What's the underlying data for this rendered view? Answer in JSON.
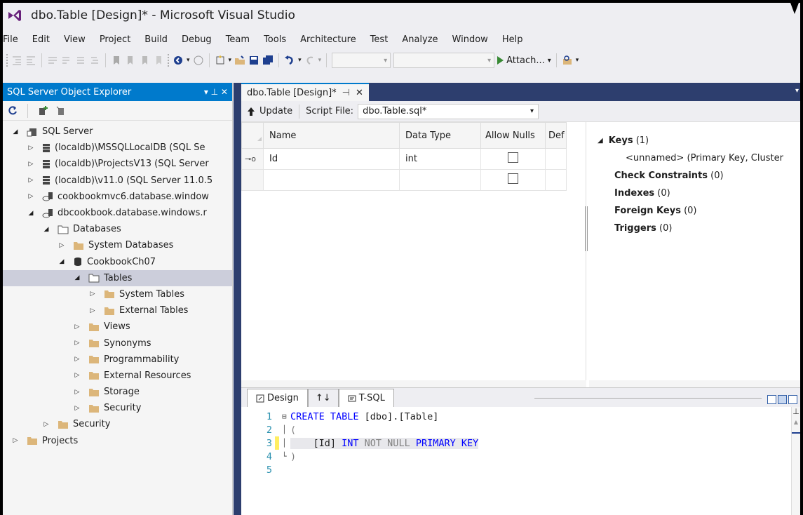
{
  "window": {
    "title": "dbo.Table [Design]* - Microsoft Visual Studio"
  },
  "menu": [
    "File",
    "Edit",
    "View",
    "Project",
    "Build",
    "Debug",
    "Team",
    "Tools",
    "Architecture",
    "Test",
    "Analyze",
    "Window",
    "Help"
  ],
  "toolbar": {
    "attach_label": "Attach...",
    "attach_dropdown": "▾"
  },
  "explorer": {
    "title": "SQL Server Object Explorer",
    "pin_glyph": "▾ ⊥ ✕",
    "tree": [
      {
        "label": "SQL Server",
        "level": 0,
        "arrow": "expanded",
        "icon": "server-group-icon"
      },
      {
        "label": "(localdb)\\MSSQLLocalDB (SQL Se",
        "level": 1,
        "arrow": "collapsed",
        "icon": "server-icon"
      },
      {
        "label": "(localdb)\\ProjectsV13 (SQL Server",
        "level": 1,
        "arrow": "collapsed",
        "icon": "server-icon"
      },
      {
        "label": "(localdb)\\v11.0 (SQL Server 11.0.5",
        "level": 1,
        "arrow": "collapsed",
        "icon": "server-icon"
      },
      {
        "label": "cookbookmvc6.database.window",
        "level": 1,
        "arrow": "collapsed",
        "icon": "azure-server-icon"
      },
      {
        "label": "dbcookbook.database.windows.r",
        "level": 1,
        "arrow": "expanded",
        "icon": "azure-server-icon"
      },
      {
        "label": "Databases",
        "level": 2,
        "arrow": "expanded",
        "icon": "folder-open-icon"
      },
      {
        "label": "System Databases",
        "level": 3,
        "arrow": "collapsed",
        "icon": "folder-icon"
      },
      {
        "label": "CookbookCh07",
        "level": 3,
        "arrow": "expanded",
        "icon": "database-icon"
      },
      {
        "label": "Tables",
        "level": 4,
        "arrow": "expanded",
        "icon": "folder-open-icon",
        "selected": true
      },
      {
        "label": "System Tables",
        "level": 5,
        "arrow": "collapsed",
        "icon": "folder-icon"
      },
      {
        "label": "External Tables",
        "level": 5,
        "arrow": "collapsed",
        "icon": "folder-icon"
      },
      {
        "label": "Views",
        "level": 4,
        "arrow": "collapsed",
        "icon": "folder-icon"
      },
      {
        "label": "Synonyms",
        "level": 4,
        "arrow": "collapsed",
        "icon": "folder-icon"
      },
      {
        "label": "Programmability",
        "level": 4,
        "arrow": "collapsed",
        "icon": "folder-icon"
      },
      {
        "label": "External Resources",
        "level": 4,
        "arrow": "collapsed",
        "icon": "folder-icon"
      },
      {
        "label": "Storage",
        "level": 4,
        "arrow": "collapsed",
        "icon": "folder-icon"
      },
      {
        "label": "Security",
        "level": 4,
        "arrow": "collapsed",
        "icon": "folder-icon"
      },
      {
        "label": "Security",
        "level": 2,
        "arrow": "collapsed",
        "icon": "folder-icon"
      },
      {
        "label": "Projects",
        "level": 0,
        "arrow": "collapsed",
        "icon": "folder-icon"
      }
    ]
  },
  "doc_tab": {
    "label": "dbo.Table [Design]*",
    "pin": "⊣",
    "close": "✕"
  },
  "designer": {
    "update_label": "Update",
    "script_file_label": "Script File:",
    "script_file_value": "dbo.Table.sql*",
    "columns_header": [
      "Name",
      "Data Type",
      "Allow Nulls",
      "Def"
    ],
    "rows": [
      {
        "name": "Id",
        "type": "int",
        "allow_nulls": false,
        "is_key": true
      },
      {
        "name": "",
        "type": "",
        "allow_nulls": false,
        "is_key": false
      }
    ],
    "props": {
      "keys_label": "Keys",
      "keys_count": "(1)",
      "keys_item": "<unnamed>  (Primary Key, Cluster",
      "check_label": "Check Constraints",
      "check_count": "(0)",
      "indexes_label": "Indexes",
      "indexes_count": "(0)",
      "fk_label": "Foreign Keys",
      "fk_count": "(0)",
      "triggers_label": "Triggers",
      "triggers_count": "(0)"
    },
    "bottom_tabs": {
      "design": "Design",
      "swap": "↑↓",
      "tsql": "T-SQL"
    }
  },
  "code": [
    {
      "num": "1",
      "fold": "⊟",
      "parts": [
        [
          "kw",
          "CREATE TABLE "
        ],
        [
          "",
          "[dbo]."
        ],
        [
          "",
          "[Table]"
        ]
      ]
    },
    {
      "num": "2",
      "fold": "│",
      "parts": [
        [
          "gray",
          "("
        ]
      ]
    },
    {
      "num": "3",
      "fold": "│",
      "changed": true,
      "parts": [
        [
          "",
          "    [Id] "
        ],
        [
          "kw",
          "INT "
        ],
        [
          "gray",
          "NOT NULL "
        ],
        [
          "kw",
          "PRIMARY KEY"
        ]
      ]
    },
    {
      "num": "4",
      "fold": "└",
      "parts": [
        [
          "gray",
          ")"
        ]
      ]
    },
    {
      "num": "5",
      "fold": "",
      "parts": []
    }
  ],
  "colors": {
    "accent": "#007ACC",
    "dark_chrome": "#2D3E6E",
    "keyword": "#0000FF",
    "line_number": "#2B91AF"
  }
}
